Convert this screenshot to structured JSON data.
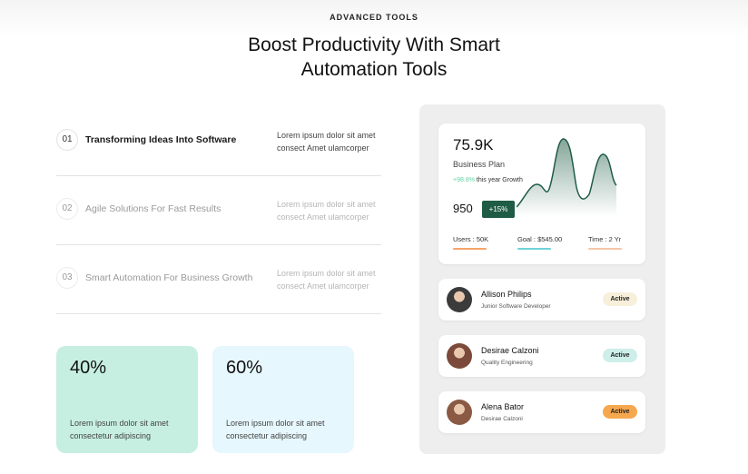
{
  "eyebrow": "ADVANCED TOOLS",
  "headline": {
    "line1": "Boost Productivity With Smart",
    "line2": "Automation Tools"
  },
  "features": [
    {
      "num": "01",
      "title": "Transforming Ideas Into Software",
      "desc": "Lorem ipsum dolor sit amet consect Amet ulamcorper",
      "active": true
    },
    {
      "num": "02",
      "title": "Agile Solutions For Fast Results",
      "desc": "Lorem ipsum dolor sit amet consect Amet ulamcorper",
      "active": false
    },
    {
      "num": "03",
      "title": "Smart Automation For Business Growth",
      "desc": "Lorem ipsum dolor sit amet consect Amet ulamcorper",
      "active": false
    }
  ],
  "stats": [
    {
      "value": "40%",
      "text": "Lorem ipsum dolor sit amet consectetur adipiscing",
      "color": "#c6efe1"
    },
    {
      "value": "60%",
      "text": "Lorem ipsum dolor sit amet consectetur adipiscing",
      "color": "#e6f7fd"
    }
  ],
  "dashboard": {
    "value": "75.9K",
    "plan": "Business Plan",
    "growth_pct": "+98.8%",
    "growth_text": "this year Growth",
    "count": "950",
    "pill": "+15%",
    "metrics": [
      {
        "label": "Users : 50K",
        "color": "#f5a46a"
      },
      {
        "label": "Goal : $545.00",
        "color": "#6fd3d8"
      },
      {
        "label": "Time : 2 Yr",
        "color": "#f7c7a8"
      }
    ],
    "chart_color": "#1f5c45"
  },
  "people": [
    {
      "name": "Allison Philips",
      "role": "Junior Software Developer",
      "status": "Active",
      "badge_color": "#f7efd9",
      "avatar_color": "#3b3b3b"
    },
    {
      "name": "Desirae Calzoni",
      "role": "Quality Engineering",
      "status": "Active",
      "badge_color": "#cdeee9",
      "avatar_color": "#7b4a3a"
    },
    {
      "name": "Alena Bator",
      "role": "Desirae Calzoni",
      "status": "Active",
      "badge_color": "#f6a84e",
      "avatar_color": "#8a5a44"
    }
  ]
}
